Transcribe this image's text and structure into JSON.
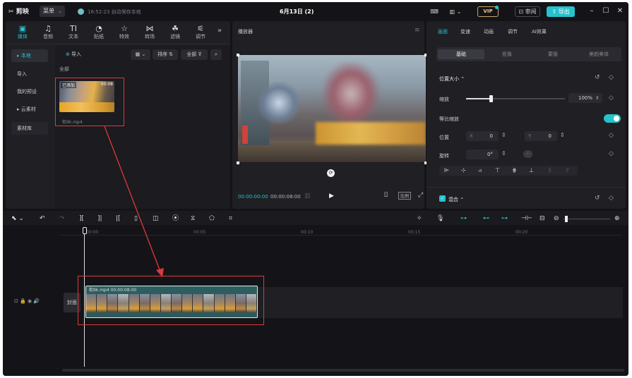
{
  "titlebar": {
    "app_name": "剪映",
    "menu_label": "菜单",
    "status": "16:52:23 自动保存本地",
    "title": "6月13日 (2)",
    "vip": "VIP",
    "review": "审阅",
    "export": "导出"
  },
  "media_toolbar": [
    {
      "icon": "media-icon",
      "glyph": "▣",
      "label": "媒体"
    },
    {
      "icon": "audio-icon",
      "glyph": "♫",
      "label": "音频"
    },
    {
      "icon": "text-icon",
      "glyph": "TI",
      "label": "文本"
    },
    {
      "icon": "sticker-icon",
      "glyph": "◔",
      "label": "贴纸"
    },
    {
      "icon": "effects-icon",
      "glyph": "☆",
      "label": "特效"
    },
    {
      "icon": "transition-icon",
      "glyph": "⋈",
      "label": "转场"
    },
    {
      "icon": "filter-icon",
      "glyph": "☘",
      "label": "滤镜"
    },
    {
      "icon": "adjust-icon",
      "glyph": "⚟",
      "label": "调节"
    }
  ],
  "sidebar": [
    {
      "label": "▸ 本地",
      "selected": true
    },
    {
      "label": "导入",
      "selected": false
    },
    {
      "label": "我的预设",
      "selected": false
    },
    {
      "label": "▸ 云素材",
      "selected": false
    },
    {
      "label": "素材库",
      "selected": false
    }
  ],
  "media": {
    "import": "导入",
    "sort": "排序",
    "all": "全部",
    "section": "全部",
    "badge": "已添加",
    "duration": "00:08",
    "filename": "街9k.mp4"
  },
  "player": {
    "title": "播放器",
    "current": "00:00:00:00",
    "total": "00:00:08:00",
    "ratio": "比例"
  },
  "inspector": {
    "tabs": [
      "画面",
      "变速",
      "动画",
      "调节",
      "AI效果"
    ],
    "subtabs": [
      "基础",
      "抠像",
      "蒙版",
      "美颜美体"
    ],
    "section_title": "位置大小",
    "scale_label": "缩放",
    "scale_value": "100%",
    "scale_fraction": 0.25,
    "uniform_label": "等比缩放",
    "position_label": "位置",
    "pos_x_key": "X",
    "pos_x": "0",
    "pos_y_key": "Y",
    "pos_y": "0",
    "rotation_label": "旋转",
    "rotation": "0°",
    "blend_label": "混合"
  },
  "timeline": {
    "ticks": [
      "00:00",
      "00:05",
      "00:10",
      "00:15",
      "00:20"
    ],
    "cover_label": "封面",
    "clip_name": "街9k.mp4",
    "clip_duration": "00:00:08:00"
  },
  "colors": {
    "accent": "#27c2cc",
    "annotation": "#e0383a"
  }
}
